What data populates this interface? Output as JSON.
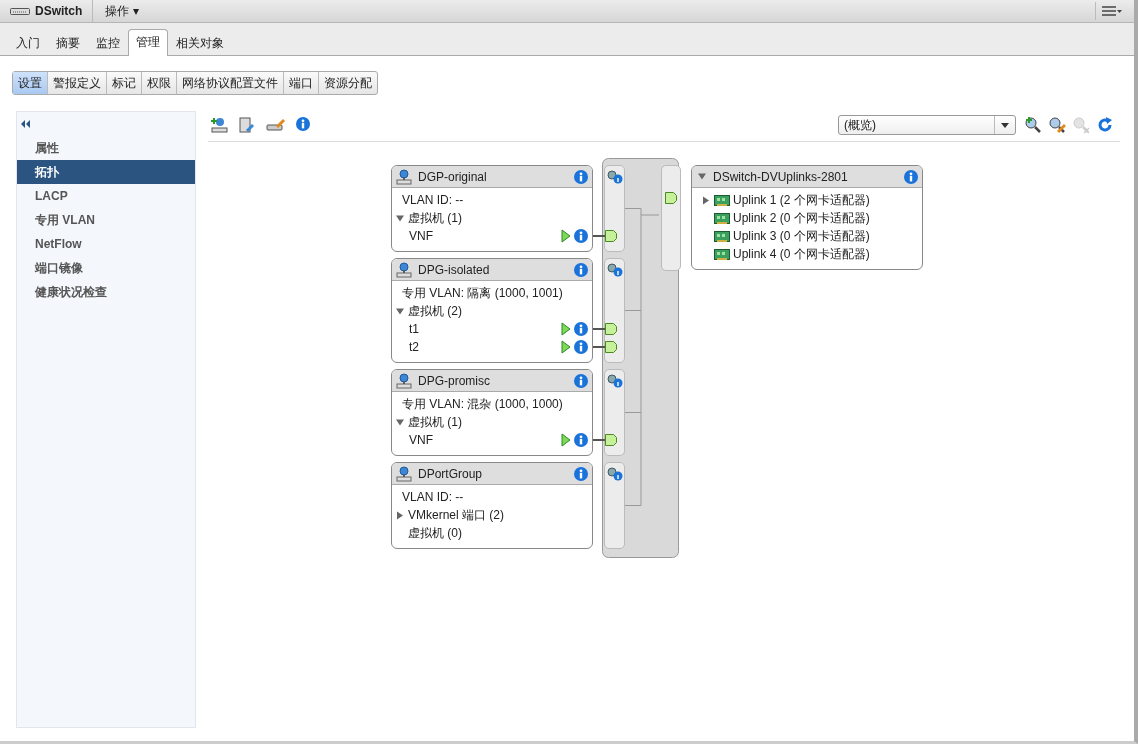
{
  "header": {
    "title": "DSwitch",
    "actions_menu": "操作 ▾"
  },
  "tabs": [
    {
      "label": "入门",
      "selected": false
    },
    {
      "label": "摘要",
      "selected": false
    },
    {
      "label": "监控",
      "selected": false
    },
    {
      "label": "管理",
      "selected": true
    },
    {
      "label": "相关对象",
      "selected": false
    }
  ],
  "subtabs": [
    {
      "label": "设置",
      "selected": true
    },
    {
      "label": "警报定义",
      "selected": false
    },
    {
      "label": "标记",
      "selected": false
    },
    {
      "label": "权限",
      "selected": false
    },
    {
      "label": "网络协议配置文件",
      "selected": false
    },
    {
      "label": "端口",
      "selected": false
    },
    {
      "label": "资源分配",
      "selected": false
    }
  ],
  "sidebar": {
    "items": [
      {
        "label": "属性",
        "selected": false
      },
      {
        "label": "拓扑",
        "selected": true
      },
      {
        "label": "LACP",
        "selected": false
      },
      {
        "label": "专用 VLAN",
        "selected": false
      },
      {
        "label": "NetFlow",
        "selected": false
      },
      {
        "label": "端口镜像",
        "selected": false
      },
      {
        "label": "健康状况检查",
        "selected": false
      }
    ]
  },
  "toolbar": {
    "view_select": "(概览)",
    "zoom_tools": [
      {
        "disabled": false
      },
      {
        "disabled": false
      },
      {
        "disabled": true
      },
      {
        "disabled": false
      }
    ]
  },
  "port_groups": [
    {
      "name": "DGP-original",
      "info": "VLAN ID: --",
      "sections": [
        {
          "label": "虚拟机 (1)",
          "expanded": true,
          "items": [
            "VNF"
          ]
        }
      ]
    },
    {
      "name": "DPG-isolated",
      "info": "专用 VLAN: 隔离 (1000, 1001)",
      "sections": [
        {
          "label": "虚拟机 (2)",
          "expanded": true,
          "items": [
            "t1",
            "t2"
          ]
        }
      ]
    },
    {
      "name": "DPG-promisc",
      "info": "专用 VLAN: 混杂 (1000, 1000)",
      "sections": [
        {
          "label": "虚拟机 (1)",
          "expanded": true,
          "items": [
            "VNF"
          ]
        }
      ]
    },
    {
      "name": "DPortGroup",
      "info": "VLAN ID: --",
      "sections": [
        {
          "label": "VMkernel 端口 (2)",
          "expanded": false
        },
        {
          "label": "虚拟机 (0)"
        }
      ]
    }
  ],
  "uplink_group": {
    "name": "DSwitch-DVUplinks-2801",
    "expanded": true,
    "uplinks": [
      {
        "label": "Uplink 1 (2 个网卡适配器)",
        "expanded": false
      },
      {
        "label": "Uplink 2 (0 个网卡适配器)"
      },
      {
        "label": "Uplink 3 (0 个网卡适配器)"
      },
      {
        "label": "Uplink 4 (0 个网卡适配器)"
      }
    ]
  }
}
